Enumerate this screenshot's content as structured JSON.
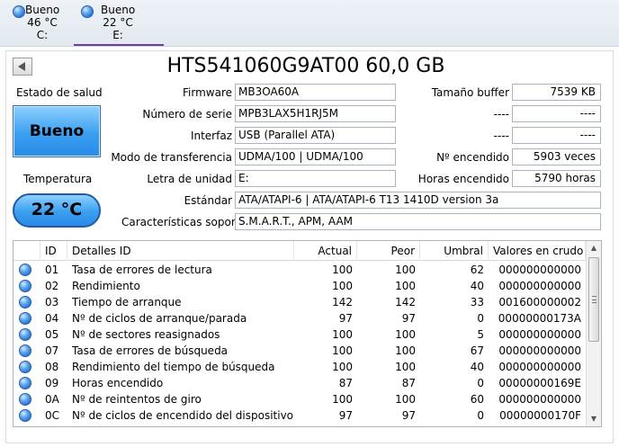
{
  "drives": [
    {
      "status": "Bueno",
      "temp": "46 °C",
      "letter": "C:",
      "active": false
    },
    {
      "status": "Bueno",
      "temp": "22 °C",
      "letter": "E:",
      "active": true
    }
  ],
  "title": "HTS541060G9AT00 60,0 GB",
  "labels": {
    "health": "Estado de salud",
    "temperature": "Temperatura",
    "firmware": "Firmware",
    "serial": "Número de serie",
    "interface": "Interfaz",
    "transfer_mode": "Modo de transferencia",
    "drive_letter": "Letra de unidad",
    "standard": "Estándar",
    "features": "Características soportad",
    "buffer": "Tamaño buffer",
    "blank1": "----",
    "blank2": "----",
    "power_on_count": "Nº encendido",
    "power_on_hours": "Horas encendido"
  },
  "values": {
    "health": "Bueno",
    "temperature": "22 °C",
    "firmware": "MB3OA60A",
    "serial": "MPB3LAX5H1RJ5M",
    "interface": "USB (Parallel ATA)",
    "transfer_mode": "UDMA/100 | UDMA/100",
    "drive_letter": "E:",
    "standard": "ATA/ATAPI-6 | ATA/ATAPI-6 T13 1410D version 3a",
    "features": "S.M.A.R.T., APM, AAM",
    "buffer": "7539 KB",
    "blank1": "----",
    "blank2": "----",
    "power_on_count": "5903 veces",
    "power_on_hours": "5790 horas"
  },
  "table": {
    "headers": [
      "ID",
      "Detalles ID",
      "Actual",
      "Peor",
      "Umbral",
      "Valores en crudo"
    ],
    "rows": [
      [
        "01",
        "Tasa de errores de lectura",
        "100",
        "100",
        "62",
        "000000000000"
      ],
      [
        "02",
        "Rendimiento",
        "100",
        "100",
        "40",
        "000000000000"
      ],
      [
        "03",
        "Tiempo de arranque",
        "142",
        "142",
        "33",
        "001600000002"
      ],
      [
        "04",
        "Nº de ciclos de arranque/parada",
        "97",
        "97",
        "0",
        "00000000173A"
      ],
      [
        "05",
        "Nº de sectores reasignados",
        "100",
        "100",
        "5",
        "000000000000"
      ],
      [
        "07",
        "Tasa de errores de búsqueda",
        "100",
        "100",
        "67",
        "000000000000"
      ],
      [
        "08",
        "Rendimiento del tiempo de búsqueda",
        "100",
        "100",
        "40",
        "000000000000"
      ],
      [
        "09",
        "Horas encendido",
        "87",
        "87",
        "0",
        "00000000169E"
      ],
      [
        "0A",
        "Nº de reintentos de giro",
        "100",
        "100",
        "60",
        "000000000000"
      ],
      [
        "0C",
        "Nº de ciclos de encendido del dispositivo",
        "97",
        "97",
        "0",
        "00000000170F"
      ]
    ]
  },
  "colors": {
    "good": "#3a9ff0",
    "active_tab": "#6a3fa5"
  }
}
